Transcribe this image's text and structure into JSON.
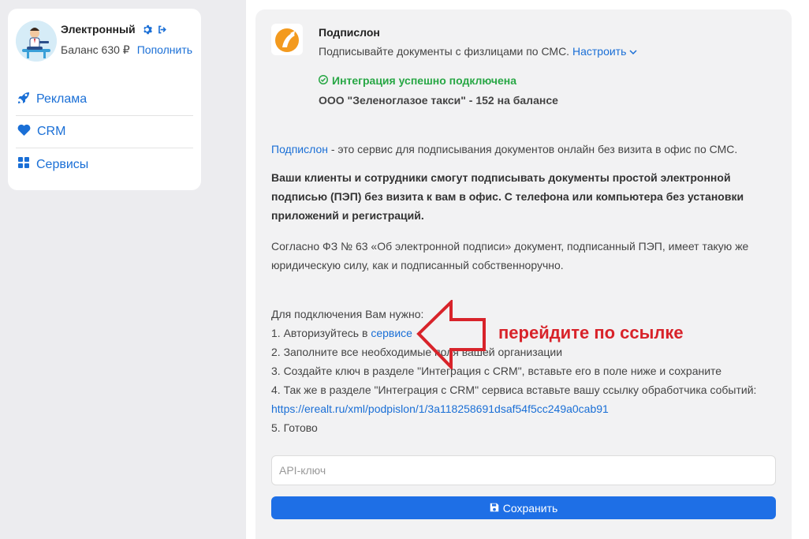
{
  "account": {
    "name": "Электронный",
    "balance_label": "Баланс 630 ₽",
    "topup_link": "Пополнить"
  },
  "menu": [
    {
      "label": "Реклама",
      "icon": "rocket-icon"
    },
    {
      "label": "CRM",
      "icon": "heart-icon"
    },
    {
      "label": "Сервисы",
      "icon": "grid-icon"
    }
  ],
  "service": {
    "title": "Подпислон",
    "subtitle": "Подписывайте документы с физлицами по СМС.",
    "configure_link": "Настроить",
    "status": "Интеграция успешно подключена",
    "company": "ООО \"Зеленоглазое такси\" - 152 на балансе"
  },
  "description": {
    "intro_link": "Подпислон",
    "intro_text": " - это сервис для подписывания документов онлайн без визита в офис по СМС.",
    "bold_par": "Ваши клиенты и сотрудники смогут подписывать документы простой электронной подписью (ПЭП) без визита к вам в офис. С телефона или компьютера без установки приложений и регистраций.",
    "law_par": "Согласно ФЗ № 63 «Об электронной подписи» документ, подписанный ПЭП, имеет такую же юридическую силу, как и подписанный собственноручно."
  },
  "steps": {
    "heading": "Для подключения Вам нужно:",
    "step1_prefix": "1. Авторизуйтесь в ",
    "step1_link": "сервисе",
    "step2": "2. Заполните все необходимые поля вашей организации",
    "step3": "3. Создайте ключ в разделе \"Интеграция с CRM\", вставьте его в поле ниже и сохраните",
    "step4": "4. Так же в разделе \"Интеграция с CRM\" сервиса вставьте вашу ссылку обработчика событий:",
    "webhook_url": "https://erealt.ru/xml/podpislon/1/3a118258691dsaf54f5cc249a0cab91",
    "step5": "5. Готово"
  },
  "form": {
    "api_placeholder": "API-ключ",
    "save_label": "Сохранить"
  },
  "annotation": {
    "text": "перейдите по ссылке",
    "color": "#d8232a"
  },
  "colors": {
    "accent": "#1e6fe6",
    "link": "#1a6fd6",
    "success": "#28a745"
  }
}
